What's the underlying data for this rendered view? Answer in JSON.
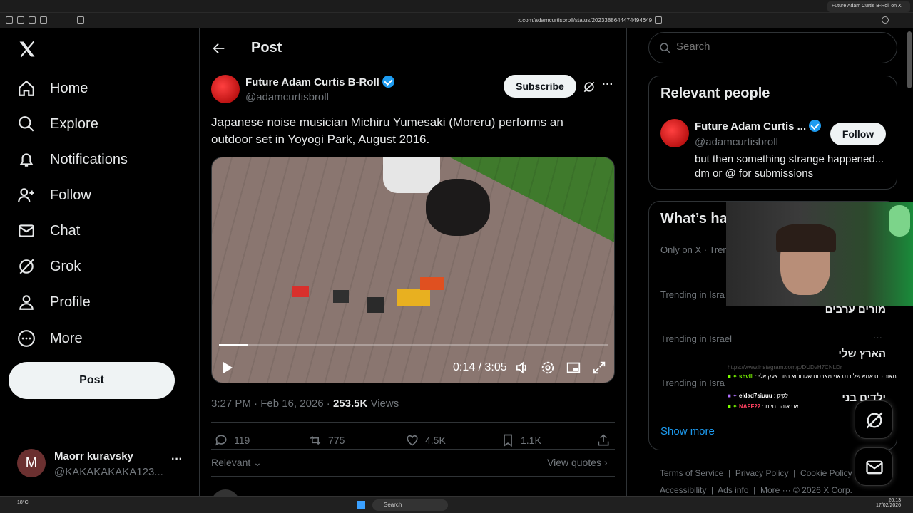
{
  "browser": {
    "tab_title": "Future Adam Curtis B-Roll on X:",
    "url": "x.com/adamcurtisbroll/status/2023388644474494649"
  },
  "nav": {
    "items": [
      {
        "label": "Home"
      },
      {
        "label": "Explore"
      },
      {
        "label": "Notifications"
      },
      {
        "label": "Follow"
      },
      {
        "label": "Chat"
      },
      {
        "label": "Grok"
      },
      {
        "label": "Profile"
      },
      {
        "label": "More"
      }
    ],
    "post_label": "Post",
    "account": {
      "name": "Maorr kuravsky",
      "handle": "@KAKAKAKAKA123...",
      "avatar_letter": "M"
    }
  },
  "main": {
    "header_title": "Post",
    "author_name": "Future Adam Curtis B-Roll",
    "author_handle": "@adamcurtisbroll",
    "subscribe_label": "Subscribe",
    "text": "Japanese noise musician Michiru Yumesaki (Moreru) performs an outdoor set in Yoyogi Park, August 2016.",
    "video": {
      "time": "0:14 / 3:05",
      "progress": 0.076
    },
    "timestamp": "3:27 PM · Feb 16, 2026 · ",
    "views_count": "253.5K",
    "views_label": " Views",
    "replies": "119",
    "reposts": "775",
    "likes": "4.5K",
    "bookmarks": "1.1K",
    "sort_label": "Relevant",
    "quotes_label": "View quotes"
  },
  "right": {
    "search_placeholder": "Search",
    "relevant_title": "Relevant people",
    "person_name": "Future Adam Curtis ...",
    "person_handle": "@adamcurtisbroll",
    "person_bio": "but then something strange happened... dm or @ for submissions",
    "follow_label": "Follow",
    "happening_title": "What’s ha",
    "trends": [
      {
        "context": "Only on X · Tren",
        "title": ""
      },
      {
        "context": "Trending in Isra",
        "title": "מורים ערבים"
      },
      {
        "context": "Trending in Israel",
        "title": "הארץ שלי"
      },
      {
        "context": "Trending in Isra",
        "title": "ילדים בני"
      }
    ],
    "show_more": "Show more",
    "footer": [
      "Terms of Service",
      "Privacy Policy",
      "Cookie Policy",
      "Accessibility",
      "Ads info",
      "More ···",
      "© 2026 X Corp."
    ]
  },
  "overlay_chat": [
    {
      "user": "",
      "text": "https://www.instagram.com/p/DUDvH7CNLDr"
    },
    {
      "user": "shvili",
      "text": "מאור כוס אמא של בנט אני מאבטח שלו והוא היום צעק אלי"
    },
    {
      "user": "eldad7siuuu",
      "text": "לקיק"
    },
    {
      "user": "NAFF22",
      "text": "אני אוהב חיות"
    }
  ],
  "taskbar": {
    "weather": "18°C",
    "search_label": "Search",
    "time": "20:13",
    "date": "17/02/2026"
  },
  "colors": {
    "accent": "#1d9bf0",
    "bg": "#000000",
    "border": "#2f3336"
  }
}
